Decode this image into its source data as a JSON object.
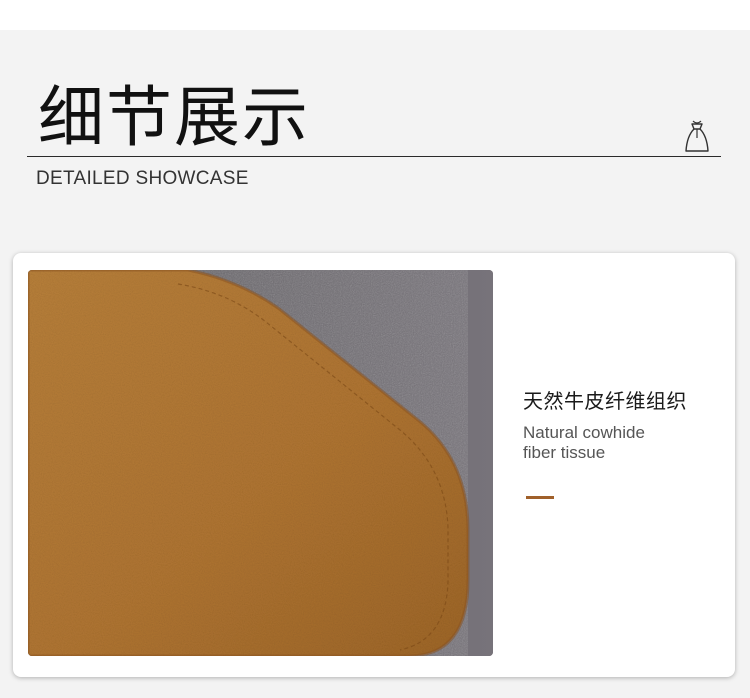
{
  "header": {
    "title": "细节展示",
    "subtitle": "DETAILED SHOWCASE",
    "icon": "gift-bag-icon"
  },
  "feature": {
    "title_zh": "天然牛皮纤维组织",
    "title_en_line1": "Natural cowhide",
    "title_en_line2": "fiber tissue",
    "photo_icon": "suede-leather-closeup"
  },
  "colors": {
    "accent": "#a0602a",
    "leather": "#b47a34",
    "backdrop": "#6a6668"
  }
}
